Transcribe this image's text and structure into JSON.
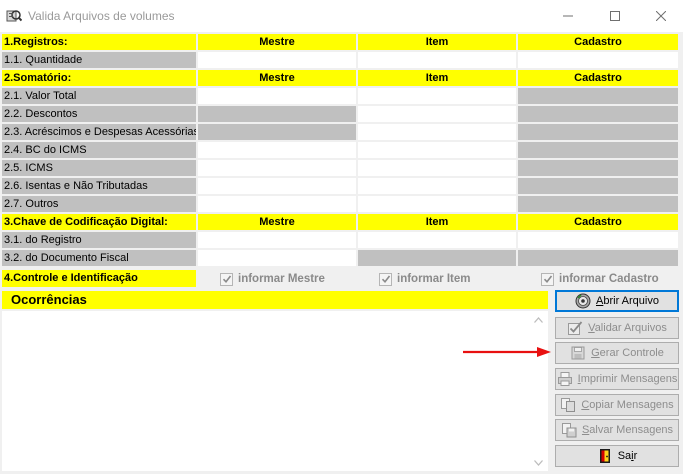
{
  "window": {
    "title": "Valida Arquivos de volumes",
    "icon": "app-icon"
  },
  "columns": {
    "mestre": "Mestre",
    "item": "Item",
    "cadastro": "Cadastro"
  },
  "sections": {
    "registros": {
      "title": "1.Registros:",
      "rows": [
        "1.1. Quantidade"
      ]
    },
    "somatorio": {
      "title": "2.Somatório:",
      "rows": [
        "2.1. Valor Total",
        "2.2. Descontos",
        "2.3. Acréscimos e Despesas Acessórias",
        "2.4. BC do ICMS",
        "2.5. ICMS",
        "2.6. Isentas e Não Tributadas",
        "2.7. Outros"
      ]
    },
    "chave": {
      "title": "3.Chave de Codificação Digital:",
      "rows": [
        "3.1. do Registro",
        "3.2. do Documento Fiscal"
      ]
    },
    "controle": {
      "title": "4.Controle e Identificação",
      "checks": {
        "mestre": "informar Mestre",
        "item": "informar Item",
        "cadastro": "informar Cadastro"
      }
    }
  },
  "ocorrencias": {
    "title": "Ocorrências"
  },
  "buttons": {
    "abrir": {
      "pre": "",
      "u": "A",
      "post": "brir Arquivo",
      "icon": "open-disc-icon"
    },
    "validar": {
      "pre": "",
      "u": "V",
      "post": "alidar Arquivos",
      "icon": "checkbox-icon"
    },
    "gerar": {
      "pre": "",
      "u": "G",
      "post": "erar Controle",
      "icon": "floppy-icon"
    },
    "imprimir": {
      "pre": "",
      "u": "I",
      "post": "mprimir Mensagens",
      "icon": "printer-icon"
    },
    "copiar": {
      "pre": "",
      "u": "C",
      "post": "opiar Mensagens",
      "icon": "copy-icon"
    },
    "salvar": {
      "pre": "",
      "u": "S",
      "post": "alvar Mensagens",
      "icon": "save-icon"
    },
    "sair": {
      "pre": "Sa",
      "u": "i",
      "post": "r",
      "icon": "exit-door-icon"
    }
  },
  "colors": {
    "header_yellow": "#ffff00",
    "label_gray": "#c0c0c0",
    "annotation_red": "#e81010",
    "focus_blue": "#0078d7"
  }
}
